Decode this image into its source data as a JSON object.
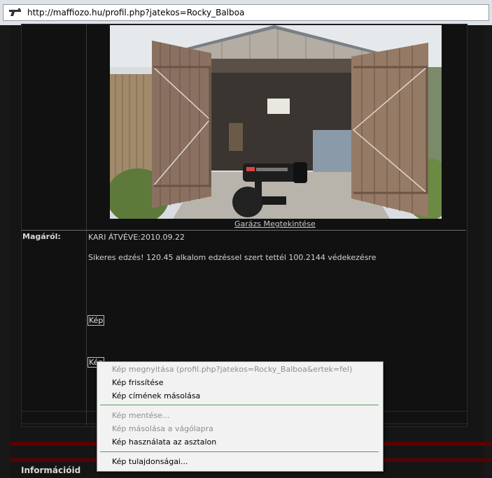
{
  "browser": {
    "url": "http://maffiozo.hu/profil.php?jatekos=Rocky_Balboa"
  },
  "profile": {
    "image_caption": "Garázs Megtekintése",
    "about_label": "Magáról:",
    "about_lines": [
      "KARI ÁTVÉVE:2010.09.22",
      "Sikeres edzés! 120.45 alkalom edzéssel szert tettél 100.2144 védekezésre"
    ],
    "image_links": [
      "Kép",
      "Kép"
    ],
    "section_title": "Információid"
  },
  "context_menu": {
    "items": [
      {
        "label": "Kép megnyitása (profil.php?jatekos=Rocky_Balboa&ertek=fel)",
        "enabled": false
      },
      {
        "label": "Kép frissítése",
        "enabled": true
      },
      {
        "label": "Kép címének másolása",
        "enabled": true
      },
      {
        "label": "Kép mentése...",
        "enabled": false
      },
      {
        "label": "Kép másolása a vágólapra",
        "enabled": false
      },
      {
        "label": "Kép használata az asztalon",
        "enabled": true
      },
      {
        "label": "Kép tulajdonságai...",
        "enabled": true
      }
    ]
  },
  "colors": {
    "background": "#181818",
    "accent_red": "#5a0000",
    "menu_separator": "#5a9a5a"
  }
}
